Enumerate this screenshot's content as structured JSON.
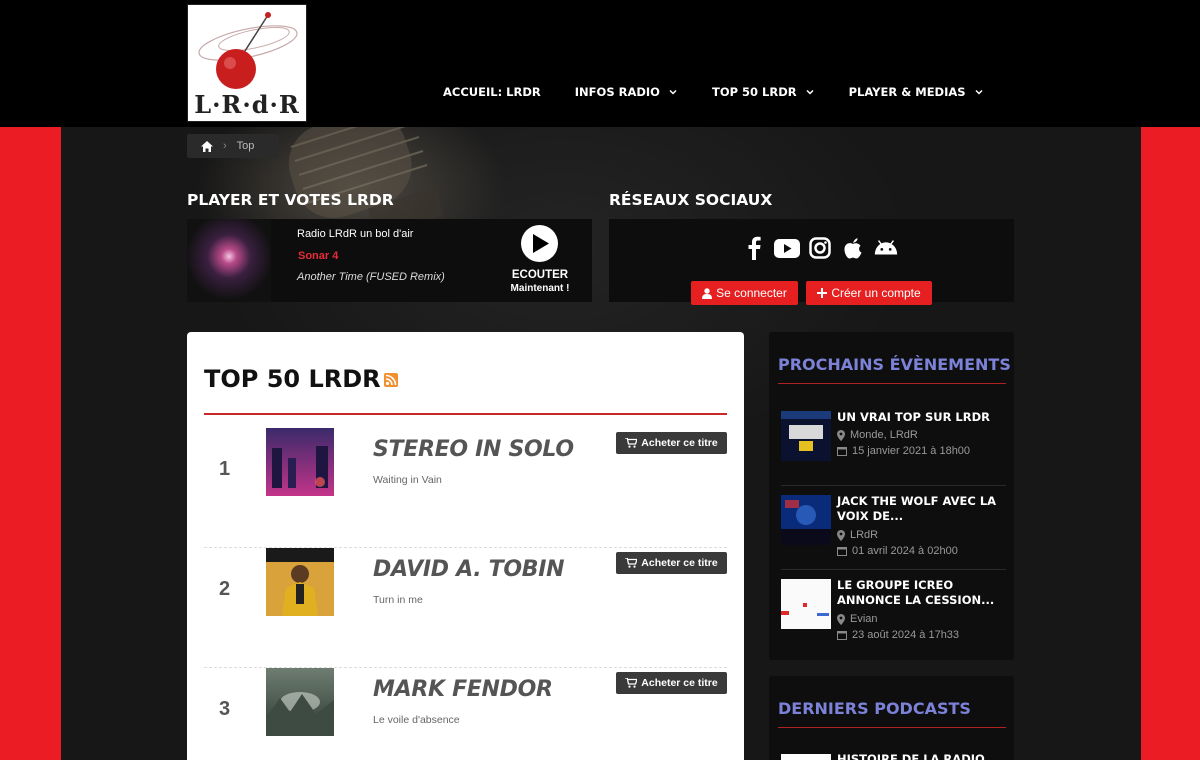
{
  "header": {
    "logo_text": "L·R·d·R",
    "nav": [
      {
        "label": "ACCUEIL: LRDR",
        "has_menu": false
      },
      {
        "label": "INFOS RADIO",
        "has_menu": true
      },
      {
        "label": "TOP 50 LRDR",
        "has_menu": true
      },
      {
        "label": "PLAYER & MEDIAS",
        "has_menu": true
      }
    ]
  },
  "breadcrumb": {
    "current": "Top"
  },
  "player_section": {
    "title": "PLAYER ET VOTES LRDR",
    "radio_name": "Radio LRdR un bol d'air",
    "artist": "Sonar 4",
    "track": "Another Time (FUSED Remix)",
    "listen_label": "ECOUTER",
    "listen_sub": "Maintenant !"
  },
  "social_section": {
    "title": "RÉSEAUX SOCIAUX",
    "icons": [
      "facebook-icon",
      "youtube-icon",
      "instagram-icon",
      "apple-icon",
      "android-icon"
    ],
    "login_label": "Se connecter",
    "register_label": "Créer un compte"
  },
  "top50": {
    "title": "TOP 50 LRDR",
    "buy_label": "Acheter ce titre",
    "tracks": [
      {
        "rank": "1",
        "artist": "STEREO IN SOLO",
        "title": "Waiting in Vain"
      },
      {
        "rank": "2",
        "artist": "DAVID A. TOBIN",
        "title": "Turn in me"
      },
      {
        "rank": "3",
        "artist": "MARK FENDOR",
        "title": "Le voile d'absence"
      }
    ]
  },
  "events": {
    "title": "PROCHAINS ÉVÈNEMENTS",
    "items": [
      {
        "title": "UN VRAI TOP SUR LRDR",
        "location": "Monde, LRdR",
        "date": "15 janvier 2021 à 18h00"
      },
      {
        "title": "JACK THE WOLF AVEC LA VOIX DE...",
        "location": "LRdR",
        "date": "01 avril 2024 à 02h00"
      },
      {
        "title": "LE GROUPE ICREO ANNONCE LA CESSION...",
        "location": "Evian",
        "date": "23 août 2024 à 17h33"
      }
    ]
  },
  "podcasts": {
    "title": "DERNIERS PODCASTS",
    "first_item": "HISTOIRE DE LA RADIO"
  },
  "colors": {
    "brand_red": "#ec1c24",
    "accent_blue": "#7b82d8",
    "dark": "#161616"
  }
}
